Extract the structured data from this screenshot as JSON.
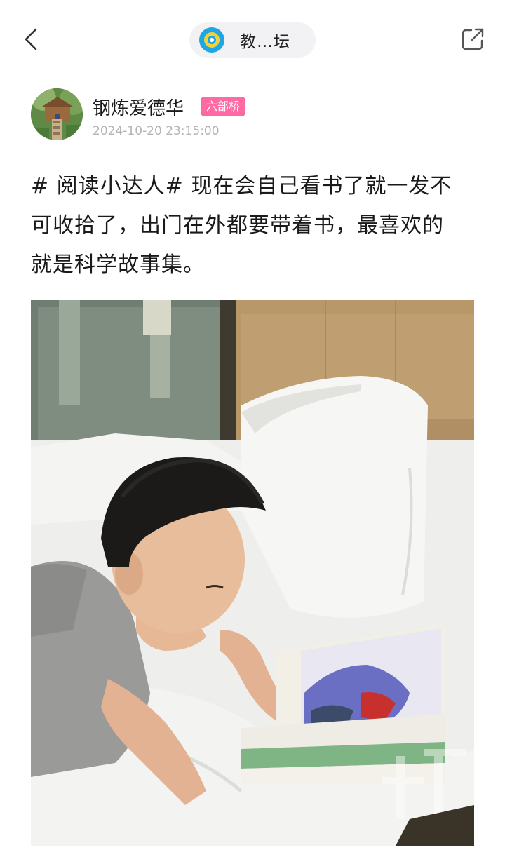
{
  "header": {
    "forum_title": "教…坛"
  },
  "author": {
    "name": "钢炼爱德华",
    "badge": "六部桥",
    "time": "2024-10-20 23:15:00"
  },
  "post": {
    "text_lines": [
      "# 阅读小达人# 现在会自己看书了就一发不",
      "可收拾了，出门在外都要带着书，最喜欢的",
      "就是科学故事集。"
    ]
  },
  "colors": {
    "badge_pink": "#ff6aa4",
    "timestamp_gray": "#b4b4b4",
    "forum_logo_blue": "#1ea6e6",
    "forum_logo_yellow": "#f1d23a"
  },
  "icons": {
    "back": "chevron-left-icon",
    "share": "external-link-icon"
  }
}
